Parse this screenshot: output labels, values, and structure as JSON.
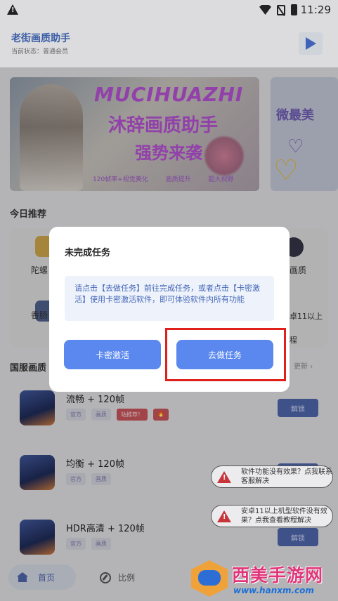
{
  "status_bar": {
    "time": "11:29"
  },
  "header": {
    "title": "老街画质助手",
    "status": "当前状态：普通会员"
  },
  "banner1": {
    "headline_en": "MUCIHUAZHI",
    "headline_cn": "沐辞画质助手",
    "headline_cn2": "强势来袭",
    "footer": "120帧率+视觉美化 画质提升 超大视野"
  },
  "banner2": {
    "text": "微最美",
    "heart": "♡",
    "heart2": "♡"
  },
  "section_today": "今日推荐",
  "recommend": {
    "left1": "陀螺",
    "left2": "香肠",
    "right1": "画质",
    "right2": "卓11以上",
    "right3": "程"
  },
  "section_cat": "国服画质",
  "cat_more": "更新 ›",
  "list": [
    {
      "name": "流畅 + 120帧",
      "tags": [
        "官方",
        "画质",
        "站推荐！",
        "🔥"
      ],
      "unlock": "解锁"
    },
    {
      "name": "均衡 + 120帧",
      "tags": [
        "官方",
        "画质"
      ],
      "unlock": "解锁"
    },
    {
      "name": "HDR高清 + 120帧",
      "tags": [
        "官方",
        "画质"
      ],
      "unlock": "解锁"
    }
  ],
  "toasts": [
    "软件功能没有效果？点我联系客服解决",
    "安卓11以上机型软件没有效果？点我查看教程解决"
  ],
  "nav": {
    "home": "首页",
    "ratio": "比例"
  },
  "watermark": {
    "title": "西美手游网",
    "url": "www.hanxm.com"
  },
  "dialog": {
    "title": "未完成任务",
    "message": "请点击【去做任务】前往完成任务，或者点击【卡密激活】使用卡密激活软件，即可体验软件内所有功能",
    "btn_card": "卡密激活",
    "btn_task": "去做任务"
  },
  "colors": {
    "accent": "#5a88ee",
    "highlight": "#e0201b",
    "brand": "#3c5ea6"
  }
}
